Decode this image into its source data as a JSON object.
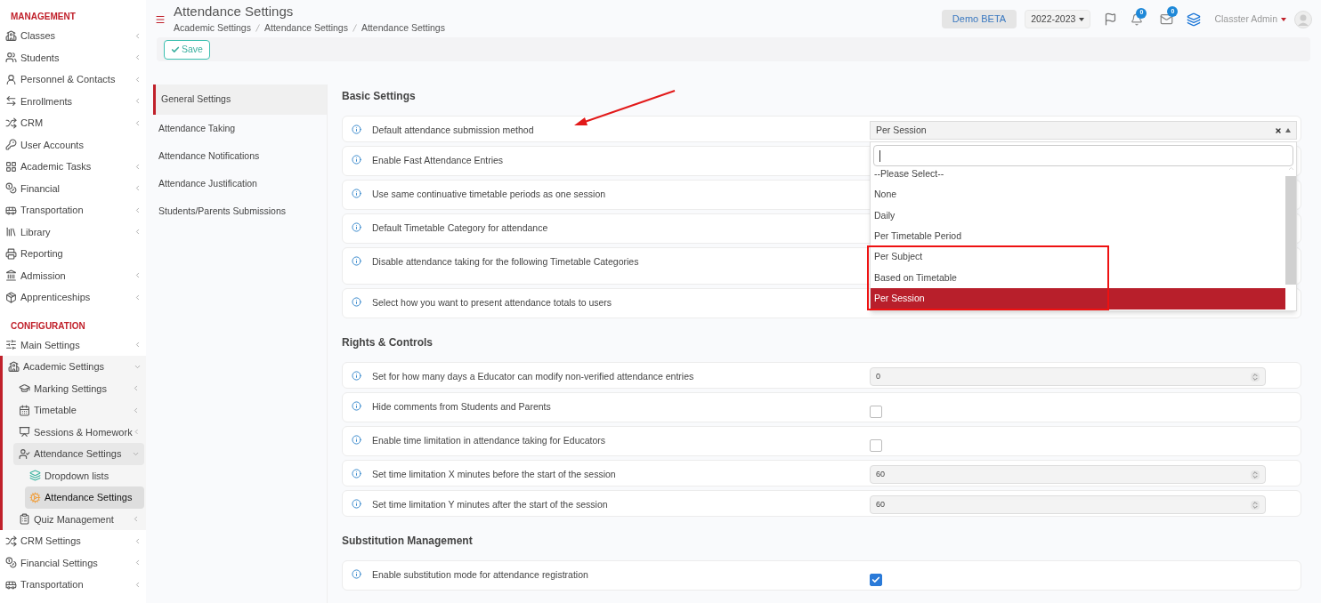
{
  "sidebar": {
    "sections": [
      {
        "title": "MANAGEMENT",
        "items": [
          {
            "label": "Classes",
            "expandable": true,
            "expanded": false,
            "selected": false
          },
          {
            "label": "Students",
            "expandable": true,
            "expanded": false,
            "selected": false
          },
          {
            "label": "Personnel & Contacts",
            "expandable": true,
            "expanded": false,
            "selected": false
          },
          {
            "label": "Enrollments",
            "expandable": true,
            "expanded": false,
            "selected": false
          },
          {
            "label": "CRM",
            "expandable": true,
            "expanded": false,
            "selected": false
          },
          {
            "label": "User Accounts",
            "expandable": false,
            "expanded": false,
            "selected": false
          },
          {
            "label": "Academic Tasks",
            "expandable": true,
            "expanded": false,
            "selected": false
          },
          {
            "label": "Financial",
            "expandable": true,
            "expanded": false,
            "selected": false
          },
          {
            "label": "Transportation",
            "expandable": true,
            "expanded": false,
            "selected": false
          },
          {
            "label": "Library",
            "expandable": true,
            "expanded": false,
            "selected": false
          },
          {
            "label": "Reporting",
            "expandable": false,
            "expanded": false,
            "selected": false
          },
          {
            "label": "Admission",
            "expandable": true,
            "expanded": false,
            "selected": false
          },
          {
            "label": "Apprenticeships",
            "expandable": true,
            "expanded": false,
            "selected": false
          }
        ]
      },
      {
        "title": "CONFIGURATION",
        "items": [
          {
            "label": "Main Settings",
            "expandable": true,
            "expanded": false,
            "selected": false
          },
          {
            "label": "Academic Settings",
            "expandable": true,
            "expanded": true,
            "selected": false,
            "children": [
              {
                "label": "Marking Settings",
                "expandable": true,
                "expanded": false,
                "selected": false
              },
              {
                "label": "Timetable",
                "expandable": true,
                "expanded": false,
                "selected": false
              },
              {
                "label": "Sessions & Homework",
                "expandable": true,
                "expanded": false,
                "selected": false
              },
              {
                "label": "Attendance Settings",
                "expandable": true,
                "expanded": true,
                "selected": false,
                "children": [
                  {
                    "label": "Dropdown lists",
                    "expandable": false,
                    "expanded": false,
                    "selected": false
                  },
                  {
                    "label": "Attendance Settings",
                    "expandable": false,
                    "expanded": false,
                    "selected": true
                  }
                ]
              },
              {
                "label": "Quiz Management",
                "expandable": true,
                "expanded": false,
                "selected": false
              }
            ]
          },
          {
            "label": "CRM Settings",
            "expandable": true,
            "expanded": false,
            "selected": false
          },
          {
            "label": "Financial Settings",
            "expandable": true,
            "expanded": false,
            "selected": false
          },
          {
            "label": "Transportation",
            "expandable": true,
            "expanded": false,
            "selected": false
          }
        ]
      }
    ]
  },
  "header": {
    "title": "Attendance Settings",
    "breadcrumbs": [
      "Academic Settings",
      "Attendance Settings",
      "Attendance Settings"
    ],
    "demo_button": "Demo BETA",
    "year": "2022-2023",
    "notifications_badge": "0",
    "messages_badge": "0",
    "user": "Classter Admin"
  },
  "toolbar": {
    "save_button": "Save"
  },
  "settings_nav": [
    {
      "label": "General Settings",
      "selected": true
    },
    {
      "label": "Attendance Taking",
      "selected": false
    },
    {
      "label": "Attendance Notifications",
      "selected": false
    },
    {
      "label": "Attendance Justification",
      "selected": false
    },
    {
      "label": "Students/Parents Submissions",
      "selected": false
    }
  ],
  "sections": [
    {
      "title": "Basic Settings",
      "rows": [
        {
          "label": "Default attendance submission method",
          "kind": "select",
          "value": "Per Session",
          "open": true,
          "dropdown": {
            "options": [
              {
                "label": "--Please Select--",
                "selected": false
              },
              {
                "label": "None",
                "selected": false
              },
              {
                "label": "Daily",
                "selected": false
              },
              {
                "label": "Per Timetable Period",
                "selected": false
              },
              {
                "label": "Per Subject",
                "selected": false
              },
              {
                "label": "Based on Timetable",
                "selected": false
              },
              {
                "label": "Per Session",
                "selected": true
              }
            ]
          }
        },
        {
          "label": "Enable Fast Attendance Entries",
          "kind": "covered",
          "tall": false
        },
        {
          "label": "Use same continuative timetable periods as one session",
          "kind": "covered",
          "tall": false
        },
        {
          "label": "Default Timetable Category for attendance",
          "kind": "covered",
          "tall": false
        },
        {
          "label": "Disable attendance taking for the following Timetable Categories",
          "kind": "covered",
          "tall": true
        },
        {
          "label": "Select how you want to present attendance totals to users",
          "kind": "covered",
          "tall": false
        }
      ]
    },
    {
      "title": "Rights & Controls",
      "rows": [
        {
          "label": "Set for how many days a Educator can modify non-verified attendance entries",
          "kind": "number",
          "value": "0"
        },
        {
          "label": "Hide comments from Students and Parents",
          "kind": "checkbox",
          "checked": false
        },
        {
          "label": "Enable time limitation in attendance taking for Educators",
          "kind": "checkbox",
          "checked": false
        },
        {
          "label": "Set time limitation X minutes before the start of the session",
          "kind": "number",
          "value": "60"
        },
        {
          "label": "Set time limitation Y minutes after the start of the session",
          "kind": "number",
          "value": "60"
        }
      ]
    },
    {
      "title": "Substitution Management",
      "rows": [
        {
          "label": "Enable substitution mode for attendance registration",
          "kind": "checkbox",
          "checked": true
        }
      ]
    }
  ]
}
